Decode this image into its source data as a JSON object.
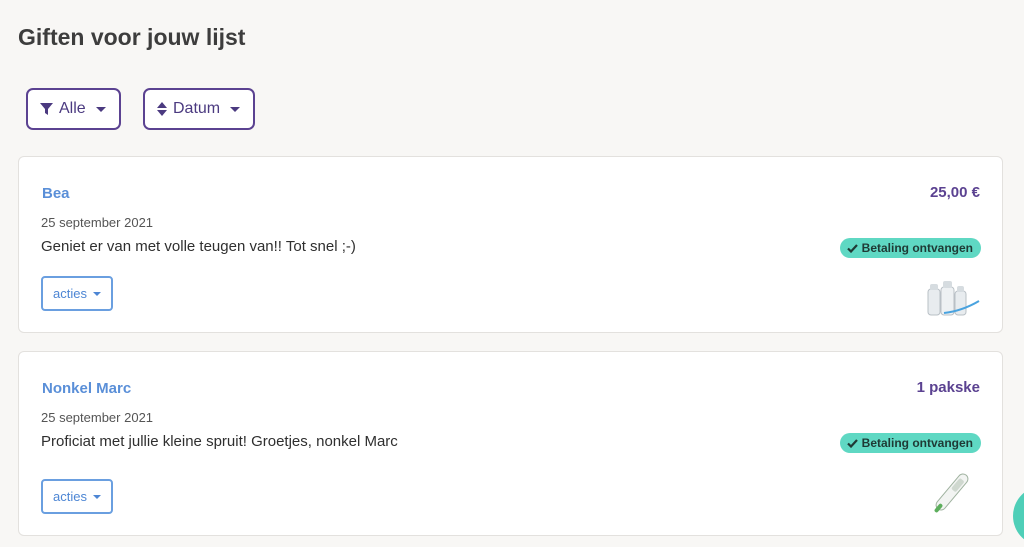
{
  "page": {
    "title": "Giften voor jouw lijst"
  },
  "filters": {
    "filter_label": "Alle",
    "sort_label": "Datum"
  },
  "gifts": [
    {
      "giver": "Bea",
      "date": "25 september 2021",
      "message": "Geniet er van met volle teugen van!! Tot snel ;-)",
      "amount": "25,00 €",
      "status": "Betaling ontvangen",
      "actions_label": "acties",
      "product_icon": "baby-bottles-icon"
    },
    {
      "giver": "Nonkel Marc",
      "date": "25 september 2021",
      "message": "Proficiat met jullie kleine spruit!  Groetjes, nonkel Marc",
      "amount": "1 pakske",
      "status": "Betaling ontvangen",
      "actions_label": "acties",
      "product_icon": "thermometer-icon"
    }
  ],
  "colors": {
    "accent": "#5b4291",
    "link": "#5a8fd8",
    "badge": "#5fd8c3"
  }
}
